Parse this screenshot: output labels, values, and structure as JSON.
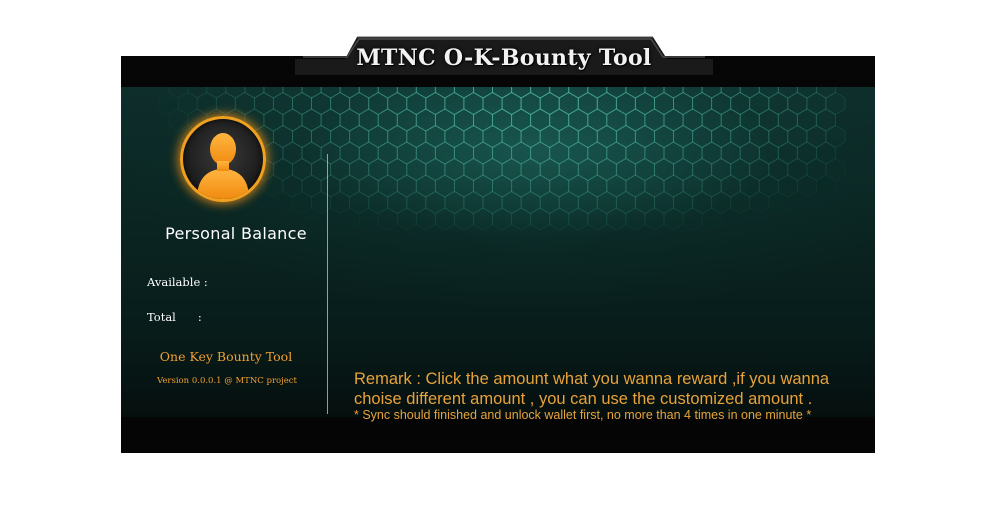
{
  "window": {
    "title": "MTNC O-K-Bounty Tool"
  },
  "balance": {
    "title": "Personal  Balance",
    "available_label": "Available :",
    "total_label": "Total",
    "total_colon": ":",
    "avatar_icon": "user-silhouette-icon"
  },
  "footer": {
    "tool_name": "One Key Bounty Tool",
    "version": "Version 0.0.0.1 @ MTNC project"
  },
  "main": {
    "remark": "Remark  :  Click the  amount what you wanna reward ,if you wanna choise different amount , you can use the customized amount .",
    "note": "* Sync should finished and unlock wallet first, no more  than 4 times in one minute *"
  },
  "colors": {
    "accent_orange": "#f0a030",
    "panel_teal": "#0e2e2b",
    "frame_black": "#060606"
  }
}
